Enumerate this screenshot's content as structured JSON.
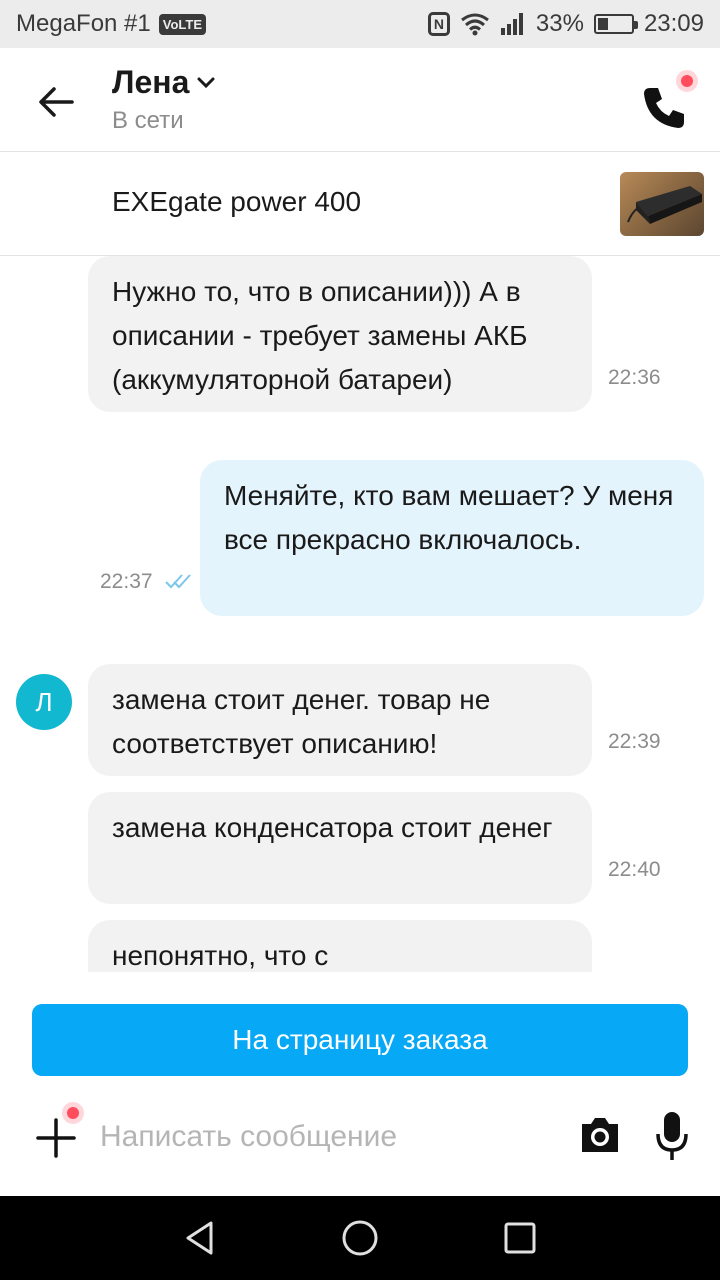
{
  "status_bar": {
    "carrier": "MegaFon #1",
    "volte": "VoLTE",
    "nfc": "N",
    "battery": "33%",
    "battery_level": 0.33,
    "time": "23:09"
  },
  "header": {
    "name": "Лена",
    "status": "В сети"
  },
  "product": {
    "title": "EXEgate power 400"
  },
  "messages": [
    {
      "direction": "in",
      "text": "Нужно то, что в описании))) А в описании - требует замены АКБ (аккумуляторной батареи)",
      "time": "22:36"
    },
    {
      "direction": "out",
      "text": "Меняйте, кто вам мешает? У меня все прекрасно включалось.",
      "time": "22:37",
      "read": true
    },
    {
      "direction": "in",
      "avatar": "Л",
      "text": "замена стоит денег. товар не соответствует описанию!",
      "time": "22:39"
    },
    {
      "direction": "in",
      "text": "замена конденсатора стоит денег",
      "time": "22:40"
    },
    {
      "direction": "in",
      "text": "непонятно, что с",
      "time": ""
    }
  ],
  "composer": {
    "order_button": "На страницу заказа",
    "placeholder": "Написать сообщение"
  },
  "colors": {
    "accent": "#07a8f5",
    "avatar": "#12b8cf",
    "incoming_bubble": "#f2f2f2",
    "outgoing_bubble": "#e4f4fc",
    "notification_dot": "#ff4d5e"
  },
  "icons": {
    "back": "arrow-left-icon",
    "dropdown": "chevron-down-icon",
    "call": "phone-icon",
    "attach": "plus-icon",
    "camera": "camera-icon",
    "mic": "microphone-icon",
    "nav_back": "triangle-back-icon",
    "nav_home": "circle-home-icon",
    "nav_recent": "square-recent-icon"
  }
}
